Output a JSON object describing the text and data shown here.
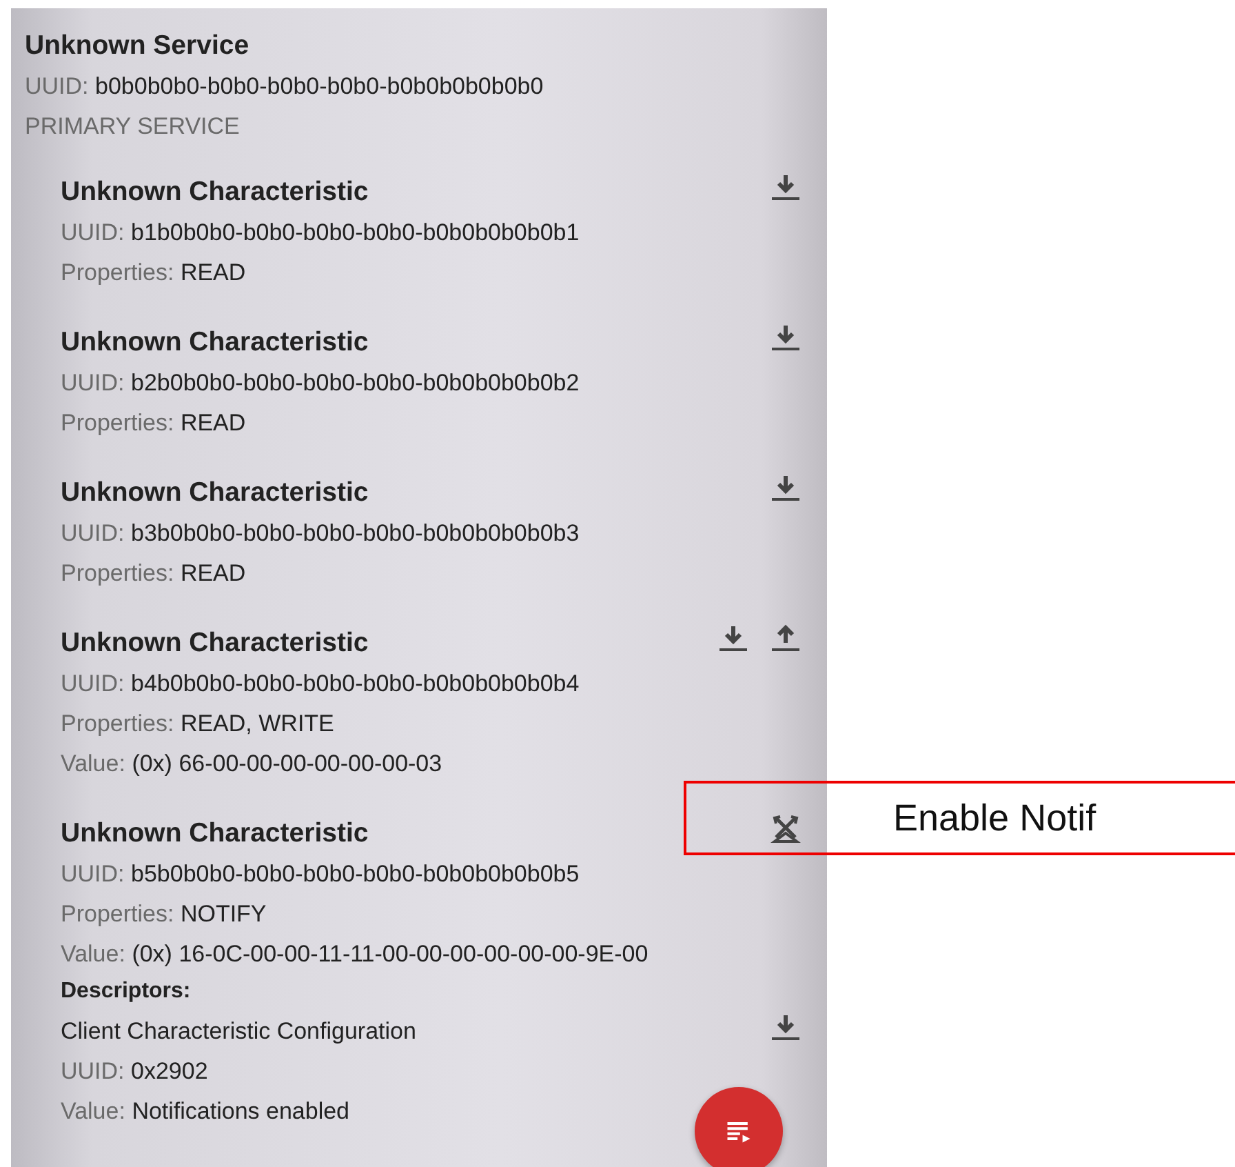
{
  "service": {
    "name": "Unknown Service",
    "uuid_label": "UUID:",
    "uuid": "b0b0b0b0-b0b0-b0b0-b0b0-b0b0b0b0b0b0",
    "type": "PRIMARY SERVICE"
  },
  "characteristics": [
    {
      "name": "Unknown Characteristic",
      "actions": [
        {
          "kind": "read"
        }
      ],
      "lines": [
        {
          "label": "UUID:",
          "value": "b1b0b0b0-b0b0-b0b0-b0b0-b0b0b0b0b0b1"
        },
        {
          "label": "Properties:",
          "value": "READ"
        }
      ]
    },
    {
      "name": "Unknown Characteristic",
      "actions": [
        {
          "kind": "read"
        }
      ],
      "lines": [
        {
          "label": "UUID:",
          "value": "b2b0b0b0-b0b0-b0b0-b0b0-b0b0b0b0b0b2"
        },
        {
          "label": "Properties:",
          "value": "READ"
        }
      ]
    },
    {
      "name": "Unknown Characteristic",
      "actions": [
        {
          "kind": "read"
        }
      ],
      "lines": [
        {
          "label": "UUID:",
          "value": "b3b0b0b0-b0b0-b0b0-b0b0-b0b0b0b0b0b3"
        },
        {
          "label": "Properties:",
          "value": "READ"
        }
      ]
    },
    {
      "name": "Unknown Characteristic",
      "actions": [
        {
          "kind": "read"
        },
        {
          "kind": "write"
        }
      ],
      "lines": [
        {
          "label": "UUID:",
          "value": "b4b0b0b0-b0b0-b0b0-b0b0-b0b0b0b0b0b4"
        },
        {
          "label": "Properties:",
          "value": "READ, WRITE"
        },
        {
          "label": "Value:",
          "value": "(0x) 66-00-00-00-00-00-00-03"
        }
      ]
    },
    {
      "name": "Unknown Characteristic",
      "actions": [
        {
          "kind": "notify"
        }
      ],
      "lines": [
        {
          "label": "UUID:",
          "value": "b5b0b0b0-b0b0-b0b0-b0b0-b0b0b0b0b0b5"
        },
        {
          "label": "Properties:",
          "value": "NOTIFY"
        },
        {
          "label": "Value:",
          "value": "(0x) 16-0C-00-00-11-11-00-00-00-00-00-00-9E-00"
        }
      ],
      "descriptors_label": "Descriptors:",
      "descriptors": [
        {
          "name": "Client Characteristic Configuration",
          "actions": [
            {
              "kind": "read"
            }
          ],
          "lines": [
            {
              "label": "UUID:",
              "value": "0x2902"
            },
            {
              "label": "Value:",
              "value": "Notifications enabled"
            }
          ]
        }
      ]
    }
  ],
  "annotation": {
    "text": "Enable Notif"
  }
}
